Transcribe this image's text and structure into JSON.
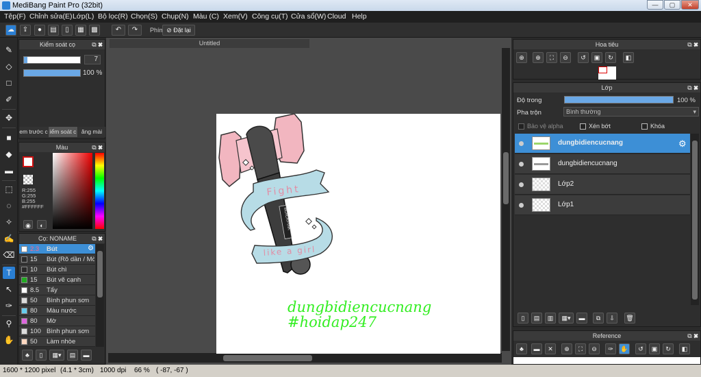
{
  "window": {
    "title": "MediBang Paint Pro (32bit)",
    "min": "—",
    "max": "▢",
    "close": "✕"
  },
  "menu": [
    "Tệp(F)",
    "Chỉnh sửa(E)",
    "Lớp(L)",
    "Bộ lọc(R)",
    "Chọn(S)",
    "Chụp(N)",
    "Màu (C)",
    "Xem(V)",
    "Công cụ(T)",
    "Cửa sổ(W)",
    "Cloud",
    "Help"
  ],
  "toolbar": {
    "shortcut_label": "Phím",
    "reset_label": "Đặt lại"
  },
  "brush_control": {
    "title": "Kiểm soát cọ",
    "size_value": "7",
    "size_fraction": 0.06,
    "opacity_label": "100 %",
    "opacity_fraction": 1.0,
    "tabs": [
      "em trước c",
      "iểm soát c",
      "ăng mài"
    ]
  },
  "color_panel": {
    "title": "Màu",
    "r": "R:255",
    "g": "G:255",
    "b": "B:255",
    "hex": "#FFFFFF",
    "primary": "#ffffff",
    "secondary": "#cc1111"
  },
  "brush_panel": {
    "title": "Cọ: NONAME",
    "brushes": [
      {
        "size": "2.3",
        "name": "Bút",
        "color": "#ffffff",
        "selected": true
      },
      {
        "size": "15",
        "name": "Bút (Rõ dần / Mờ",
        "color": "#2a2a2a",
        "selected": false
      },
      {
        "size": "10",
        "name": "Bút chì",
        "color": "#2a2a2a",
        "selected": false
      },
      {
        "size": "15",
        "name": "Bút vẽ cạnh",
        "color": "#22aa22",
        "selected": false
      },
      {
        "size": "8.5",
        "name": "Tẩy",
        "color": "#ffffff",
        "selected": false
      },
      {
        "size": "50",
        "name": "Bình phun sơn",
        "color": "#dddddd",
        "selected": false
      },
      {
        "size": "80",
        "name": "Màu nước",
        "color": "#66ccee",
        "selected": false
      },
      {
        "size": "80",
        "name": "Mờ",
        "color": "#dd66dd",
        "selected": false
      },
      {
        "size": "100",
        "name": "Bình phun sơn",
        "color": "#dddddd",
        "selected": false
      },
      {
        "size": "50",
        "name": "Làm nhòe",
        "color": "#ffd8c0",
        "selected": false
      }
    ]
  },
  "canvas": {
    "doc_title": "Untitled",
    "watermark_line1": "dungbidiencucnang",
    "watermark_line2": "#hoidap247",
    "ribbon_top": "Fight",
    "ribbon_bottom": "like a girl",
    "stick_text": "BLACKPINK"
  },
  "navigator": {
    "title": "Hoa tiêu"
  },
  "layer_panel": {
    "title": "Lớp",
    "opacity_label": "Độ trong",
    "opacity_value": "100 %",
    "opacity_fraction": 1.0,
    "blend_label": "Pha trộn",
    "blend_value": "Bình thường",
    "protect_alpha": "Bảo vệ alpha",
    "clip": "Xén bớt",
    "lock": "Khóa",
    "layers": [
      {
        "name": "dungbidiencucnang",
        "selected": true
      },
      {
        "name": "dungbidiencucnang",
        "selected": false
      },
      {
        "name": "Lớp2",
        "selected": false
      },
      {
        "name": "Lớp1",
        "selected": false
      }
    ]
  },
  "reference": {
    "title": "Reference"
  },
  "status": {
    "size": "1600 * 1200 pixel",
    "physical": "(4.1 * 3cm)",
    "dpi": "1000 dpi",
    "zoom": "66 %",
    "coords": "( -87, -67 )"
  },
  "colors": {
    "accent": "#3d8fd6",
    "watermark": "#33ee22"
  }
}
